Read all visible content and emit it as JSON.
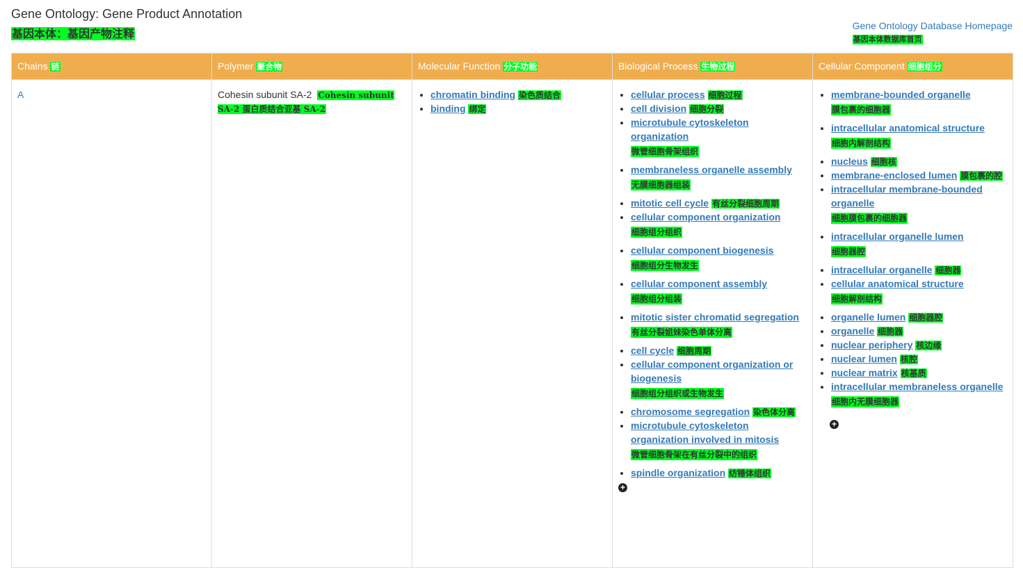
{
  "header": {
    "title": "Gene Ontology: Gene Product Annotation",
    "title_cn": "基因本体：基因产物注释",
    "home_link": "Gene Ontology Database Homepage",
    "home_link_cn": "基因本体数据库首页"
  },
  "table": {
    "columns": [
      {
        "label": "Chains",
        "cn": "链"
      },
      {
        "label": "Polymer",
        "cn": "聚合物"
      },
      {
        "label": "Molecular Function",
        "cn": "分子功能"
      },
      {
        "label": "Biological Process",
        "cn": "生物过程"
      },
      {
        "label": "Cellular Component",
        "cn": "细胞组分"
      }
    ],
    "row": {
      "chain": "A",
      "polymer": "Cohesin subunit SA-2",
      "polymer_cn": "Cohesin subunit SA-2 蛋白质结合亚基 SA-2",
      "molecular_function": [
        {
          "term": "chromatin binding",
          "cn": "染色质结合"
        },
        {
          "term": "binding",
          "cn": "绑定"
        }
      ],
      "biological_process": [
        {
          "term": "cellular process",
          "cn": "细胞过程"
        },
        {
          "term": "cell division",
          "cn": "细胞分裂"
        },
        {
          "term": "microtubule cytoskeleton organization",
          "cn": "微管细胞骨架组织"
        },
        {
          "term": "membraneless organelle assembly",
          "cn": "无膜细胞器组装"
        },
        {
          "term": "mitotic cell cycle",
          "cn": "有丝分裂细胞周期"
        },
        {
          "term": "cellular component organization",
          "cn": "细胞组分组织"
        },
        {
          "term": "cellular component biogenesis",
          "cn": "细胞组分生物发生"
        },
        {
          "term": "cellular component assembly",
          "cn": "细胞组分组装"
        },
        {
          "term": "mitotic sister chromatid segregation",
          "cn": "有丝分裂姐妹染色单体分离"
        },
        {
          "term": "cell cycle",
          "cn": "细胞周期"
        },
        {
          "term": "cellular component organization or biogenesis",
          "cn": "细胞组分组织或生物发生"
        },
        {
          "term": "chromosome segregation",
          "cn": "染色体分离"
        },
        {
          "term": "microtubule cytoskeleton organization involved in mitosis",
          "cn": "微管细胞骨架在有丝分裂中的组织"
        },
        {
          "term": "spindle organization",
          "cn": "纺锤体组织"
        }
      ],
      "cellular_component": [
        {
          "term": "membrane-bounded organelle",
          "cn": "膜包裹的细胞器"
        },
        {
          "term": "intracellular anatomical structure",
          "cn": "细胞内解剖结构"
        },
        {
          "term": "nucleus",
          "cn": "细胞核"
        },
        {
          "term": "membrane-enclosed lumen",
          "cn": "膜包裹的腔"
        },
        {
          "term": "intracellular membrane-bounded organelle",
          "cn": "细胞膜包裹的细胞器"
        },
        {
          "term": "intracellular organelle lumen",
          "cn": "细胞器腔"
        },
        {
          "term": "intracellular organelle",
          "cn": "细胞器"
        },
        {
          "term": "cellular anatomical structure",
          "cn": "细胞解剖结构"
        },
        {
          "term": "organelle lumen",
          "cn": "细胞器腔"
        },
        {
          "term": "organelle",
          "cn": "细胞器"
        },
        {
          "term": "nuclear periphery",
          "cn": "核边缘"
        },
        {
          "term": "nuclear lumen",
          "cn": "核腔"
        },
        {
          "term": "nuclear matrix",
          "cn": "核基质"
        },
        {
          "term": "intracellular membraneless organelle",
          "cn": "细胞内无膜细胞器"
        }
      ]
    }
  },
  "icons": {
    "expand": "plus-circle-icon"
  }
}
